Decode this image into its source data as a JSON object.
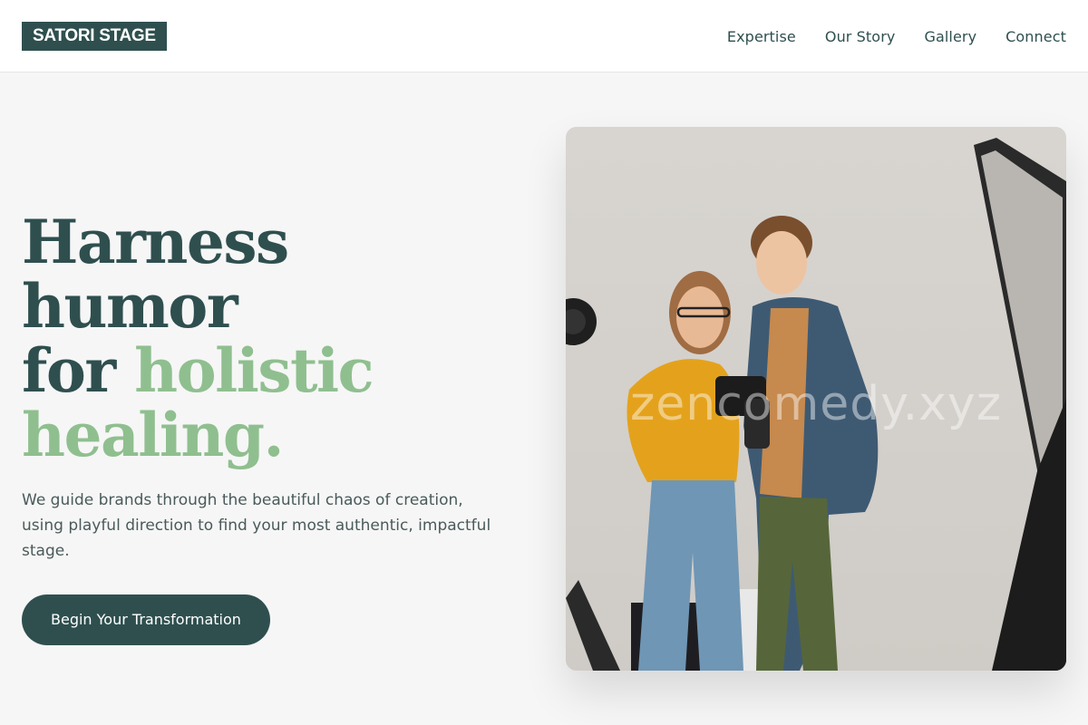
{
  "header": {
    "logo": "SATORI STAGE",
    "nav": [
      "Expertise",
      "Our Story",
      "Gallery",
      "Connect"
    ]
  },
  "hero": {
    "headline_part1": "Harness humor",
    "headline_part2": "for ",
    "headline_accent": "holistic healing.",
    "subtext": "We guide brands through the beautiful chaos of creation, using playful direction to find your most authentic, impactful stage.",
    "cta": "Begin Your Transformation",
    "image_watermark": "zencomedy.xyz"
  },
  "colors": {
    "primary": "#2f4f4f",
    "accent": "#8fbf8f",
    "background": "#f6f6f6"
  }
}
